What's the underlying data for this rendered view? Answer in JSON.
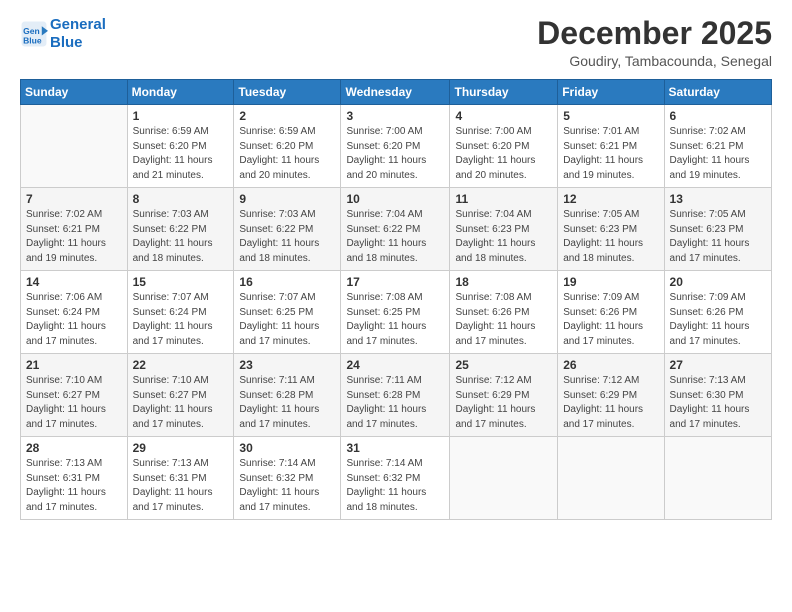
{
  "header": {
    "logo_line1": "General",
    "logo_line2": "Blue",
    "month_title": "December 2025",
    "location": "Goudiry, Tambacounda, Senegal"
  },
  "calendar": {
    "weekdays": [
      "Sunday",
      "Monday",
      "Tuesday",
      "Wednesday",
      "Thursday",
      "Friday",
      "Saturday"
    ],
    "weeks": [
      [
        {
          "day": "",
          "info": ""
        },
        {
          "day": "1",
          "info": "Sunrise: 6:59 AM\nSunset: 6:20 PM\nDaylight: 11 hours\nand 21 minutes."
        },
        {
          "day": "2",
          "info": "Sunrise: 6:59 AM\nSunset: 6:20 PM\nDaylight: 11 hours\nand 20 minutes."
        },
        {
          "day": "3",
          "info": "Sunrise: 7:00 AM\nSunset: 6:20 PM\nDaylight: 11 hours\nand 20 minutes."
        },
        {
          "day": "4",
          "info": "Sunrise: 7:00 AM\nSunset: 6:20 PM\nDaylight: 11 hours\nand 20 minutes."
        },
        {
          "day": "5",
          "info": "Sunrise: 7:01 AM\nSunset: 6:21 PM\nDaylight: 11 hours\nand 19 minutes."
        },
        {
          "day": "6",
          "info": "Sunrise: 7:02 AM\nSunset: 6:21 PM\nDaylight: 11 hours\nand 19 minutes."
        }
      ],
      [
        {
          "day": "7",
          "info": "Sunrise: 7:02 AM\nSunset: 6:21 PM\nDaylight: 11 hours\nand 19 minutes."
        },
        {
          "day": "8",
          "info": "Sunrise: 7:03 AM\nSunset: 6:22 PM\nDaylight: 11 hours\nand 18 minutes."
        },
        {
          "day": "9",
          "info": "Sunrise: 7:03 AM\nSunset: 6:22 PM\nDaylight: 11 hours\nand 18 minutes."
        },
        {
          "day": "10",
          "info": "Sunrise: 7:04 AM\nSunset: 6:22 PM\nDaylight: 11 hours\nand 18 minutes."
        },
        {
          "day": "11",
          "info": "Sunrise: 7:04 AM\nSunset: 6:23 PM\nDaylight: 11 hours\nand 18 minutes."
        },
        {
          "day": "12",
          "info": "Sunrise: 7:05 AM\nSunset: 6:23 PM\nDaylight: 11 hours\nand 18 minutes."
        },
        {
          "day": "13",
          "info": "Sunrise: 7:05 AM\nSunset: 6:23 PM\nDaylight: 11 hours\nand 17 minutes."
        }
      ],
      [
        {
          "day": "14",
          "info": "Sunrise: 7:06 AM\nSunset: 6:24 PM\nDaylight: 11 hours\nand 17 minutes."
        },
        {
          "day": "15",
          "info": "Sunrise: 7:07 AM\nSunset: 6:24 PM\nDaylight: 11 hours\nand 17 minutes."
        },
        {
          "day": "16",
          "info": "Sunrise: 7:07 AM\nSunset: 6:25 PM\nDaylight: 11 hours\nand 17 minutes."
        },
        {
          "day": "17",
          "info": "Sunrise: 7:08 AM\nSunset: 6:25 PM\nDaylight: 11 hours\nand 17 minutes."
        },
        {
          "day": "18",
          "info": "Sunrise: 7:08 AM\nSunset: 6:26 PM\nDaylight: 11 hours\nand 17 minutes."
        },
        {
          "day": "19",
          "info": "Sunrise: 7:09 AM\nSunset: 6:26 PM\nDaylight: 11 hours\nand 17 minutes."
        },
        {
          "day": "20",
          "info": "Sunrise: 7:09 AM\nSunset: 6:26 PM\nDaylight: 11 hours\nand 17 minutes."
        }
      ],
      [
        {
          "day": "21",
          "info": "Sunrise: 7:10 AM\nSunset: 6:27 PM\nDaylight: 11 hours\nand 17 minutes."
        },
        {
          "day": "22",
          "info": "Sunrise: 7:10 AM\nSunset: 6:27 PM\nDaylight: 11 hours\nand 17 minutes."
        },
        {
          "day": "23",
          "info": "Sunrise: 7:11 AM\nSunset: 6:28 PM\nDaylight: 11 hours\nand 17 minutes."
        },
        {
          "day": "24",
          "info": "Sunrise: 7:11 AM\nSunset: 6:28 PM\nDaylight: 11 hours\nand 17 minutes."
        },
        {
          "day": "25",
          "info": "Sunrise: 7:12 AM\nSunset: 6:29 PM\nDaylight: 11 hours\nand 17 minutes."
        },
        {
          "day": "26",
          "info": "Sunrise: 7:12 AM\nSunset: 6:29 PM\nDaylight: 11 hours\nand 17 minutes."
        },
        {
          "day": "27",
          "info": "Sunrise: 7:13 AM\nSunset: 6:30 PM\nDaylight: 11 hours\nand 17 minutes."
        }
      ],
      [
        {
          "day": "28",
          "info": "Sunrise: 7:13 AM\nSunset: 6:31 PM\nDaylight: 11 hours\nand 17 minutes."
        },
        {
          "day": "29",
          "info": "Sunrise: 7:13 AM\nSunset: 6:31 PM\nDaylight: 11 hours\nand 17 minutes."
        },
        {
          "day": "30",
          "info": "Sunrise: 7:14 AM\nSunset: 6:32 PM\nDaylight: 11 hours\nand 17 minutes."
        },
        {
          "day": "31",
          "info": "Sunrise: 7:14 AM\nSunset: 6:32 PM\nDaylight: 11 hours\nand 18 minutes."
        },
        {
          "day": "",
          "info": ""
        },
        {
          "day": "",
          "info": ""
        },
        {
          "day": "",
          "info": ""
        }
      ]
    ]
  }
}
